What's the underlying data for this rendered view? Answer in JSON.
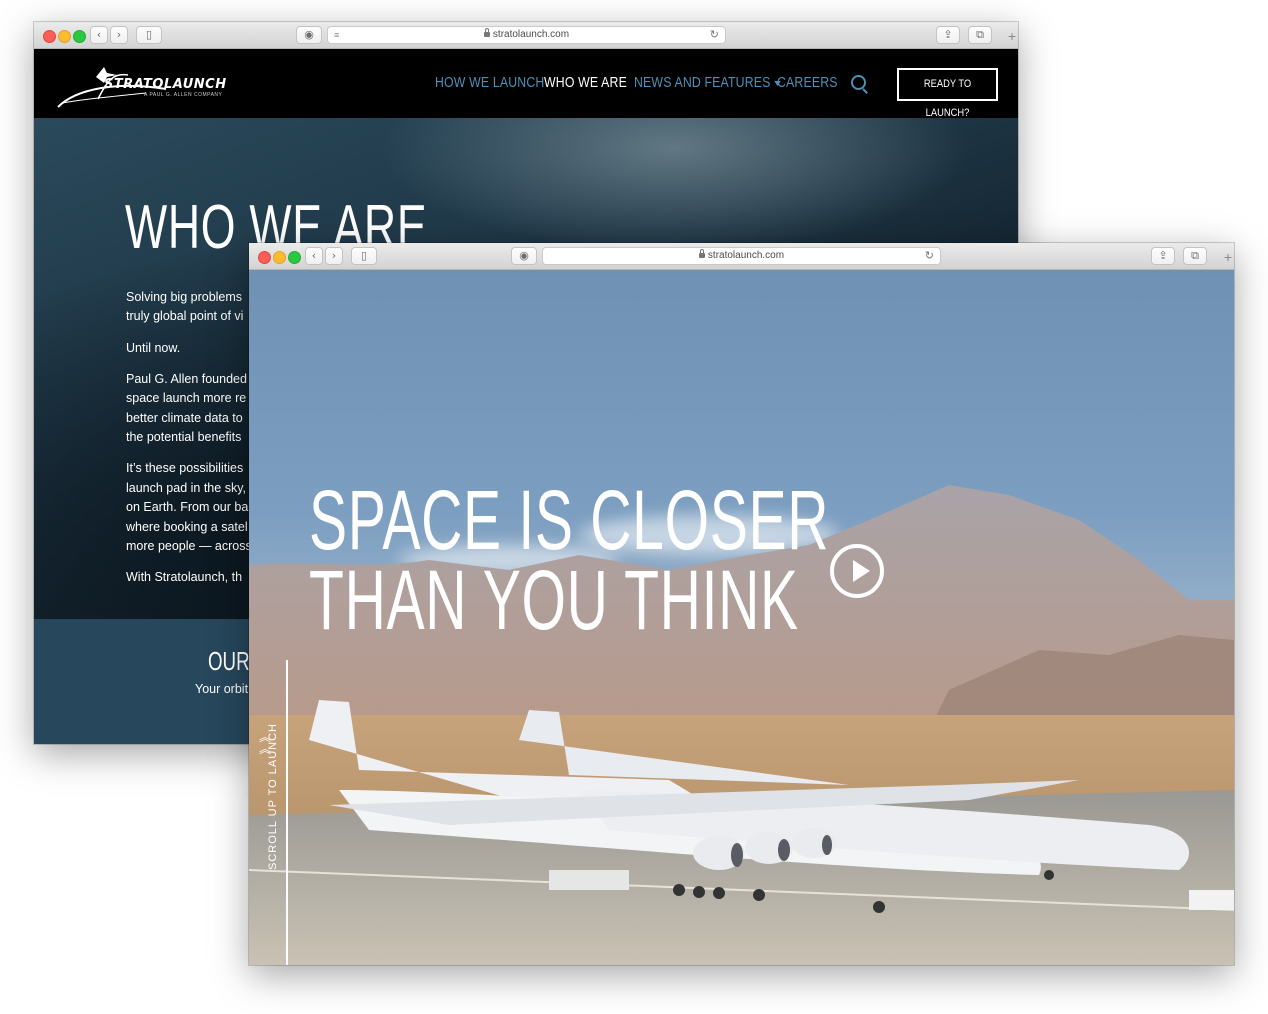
{
  "back_window": {
    "url": "stratolaunch.com",
    "logo": {
      "name": "STRATOLAUNCH",
      "tagline": "A PAUL G. ALLEN COMPANY"
    },
    "nav": [
      "HOW WE LAUNCH",
      "WHO WE ARE",
      "NEWS AND FEATURES",
      "CAREERS"
    ],
    "cta": "READY TO LAUNCH?",
    "title": "WHO WE ARE",
    "paragraphs": [
      [
        "Solving big problems",
        "truly global point of vi"
      ],
      [
        "Until now."
      ],
      [
        "Paul G. Allen founded",
        "space launch more re",
        "better climate data to",
        "the potential benefits"
      ],
      [
        "It’s these possibilities",
        "launch pad in the sky,",
        "on Earth. From our ba",
        "where booking a satel",
        "more people — across"
      ],
      [
        "With Stratolaunch, th"
      ]
    ],
    "band_title": "OUR V",
    "band_text": "Your orbit"
  },
  "front_window": {
    "url": "stratolaunch.com",
    "headline": [
      "SPACE IS CLOSER",
      "THAN YOU THINK"
    ],
    "scroll_label": "SCROLL UP TO LAUNCH"
  }
}
